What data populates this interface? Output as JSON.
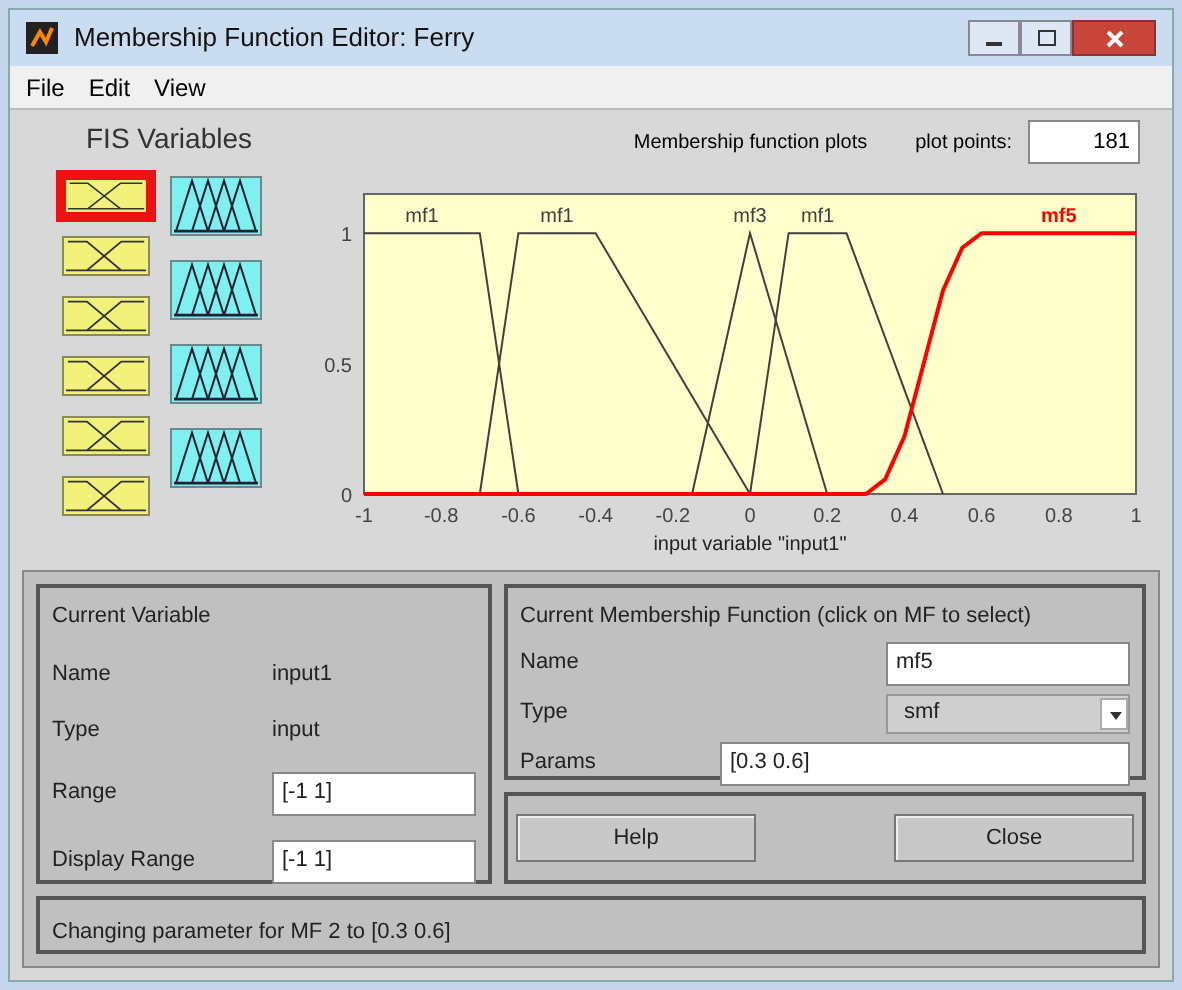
{
  "window": {
    "title": "Membership Function Editor: Ferry"
  },
  "menu": [
    "File",
    "Edit",
    "View"
  ],
  "fis_variables": {
    "title": "FIS Variables",
    "items": [
      {
        "kind": "input",
        "selected": true
      },
      {
        "kind": "input",
        "selected": false
      },
      {
        "kind": "input",
        "selected": false
      },
      {
        "kind": "input",
        "selected": false
      },
      {
        "kind": "input",
        "selected": false
      },
      {
        "kind": "input",
        "selected": false
      },
      {
        "kind": "output",
        "selected": false
      },
      {
        "kind": "output",
        "selected": false
      },
      {
        "kind": "output",
        "selected": false
      },
      {
        "kind": "output",
        "selected": false
      }
    ]
  },
  "plot_header": {
    "title": "Membership function plots",
    "plot_points_label": "plot points:",
    "plot_points": "181"
  },
  "chart_data": {
    "type": "line",
    "xlabel": "input variable \"input1\"",
    "x": [
      -1,
      -0.7,
      -0.65,
      -0.6,
      -0.4,
      -0.15,
      0,
      0.1,
      0.2,
      0.25,
      0.3,
      0.35,
      0.4,
      0.45,
      0.5,
      0.55,
      0.6,
      1
    ],
    "series": [
      {
        "name": "mf1",
        "color": "#404040",
        "values": [
          1,
          1,
          0.5,
          0,
          null,
          null,
          null,
          null,
          null,
          null,
          null,
          null,
          null,
          null,
          null,
          null,
          null,
          null
        ]
      },
      {
        "name": "mf1",
        "color": "#404040",
        "values": [
          null,
          0,
          0.5,
          1,
          1,
          0.375,
          0,
          null,
          null,
          null,
          null,
          null,
          null,
          null,
          null,
          null,
          null,
          null
        ]
      },
      {
        "name": "mf3",
        "color": "#404040",
        "values": [
          null,
          null,
          null,
          null,
          null,
          0,
          1,
          0.5,
          0,
          null,
          null,
          null,
          null,
          null,
          null,
          null,
          null,
          null
        ]
      },
      {
        "name": "mf1",
        "color": "#404040",
        "values": [
          null,
          null,
          null,
          null,
          null,
          null,
          0,
          1,
          1,
          1,
          0.8,
          0.6,
          0.4,
          0.2,
          0,
          null,
          null,
          null
        ]
      },
      {
        "name": "mf5",
        "color": "#ff0000",
        "values": [
          0,
          0,
          0,
          0,
          0,
          0,
          0,
          0,
          0,
          0,
          0,
          0.056,
          0.22,
          0.5,
          0.78,
          0.944,
          1,
          1
        ]
      }
    ],
    "xlim": [
      -1,
      1
    ],
    "ylim": [
      0,
      1.15
    ],
    "xticks": [
      -1,
      -0.8,
      -0.6,
      -0.4,
      -0.2,
      0,
      0.2,
      0.4,
      0.6,
      0.8,
      1
    ],
    "yticks": [
      0,
      0.5,
      1
    ]
  },
  "current_variable": {
    "title": "Current Variable",
    "name_label": "Name",
    "name": "input1",
    "type_label": "Type",
    "type": "input",
    "range_label": "Range",
    "range": "[-1 1]",
    "display_range_label": "Display Range",
    "display_range": "[-1 1]"
  },
  "current_mf": {
    "title": "Current Membership Function (click on MF to select)",
    "name_label": "Name",
    "name": "mf5",
    "type_label": "Type",
    "type": "smf",
    "params_label": "Params",
    "params": "[0.3 0.6]"
  },
  "buttons": [
    "Help",
    "Close"
  ],
  "status": "Changing parameter for MF 2 to  [0.3 0.6]"
}
